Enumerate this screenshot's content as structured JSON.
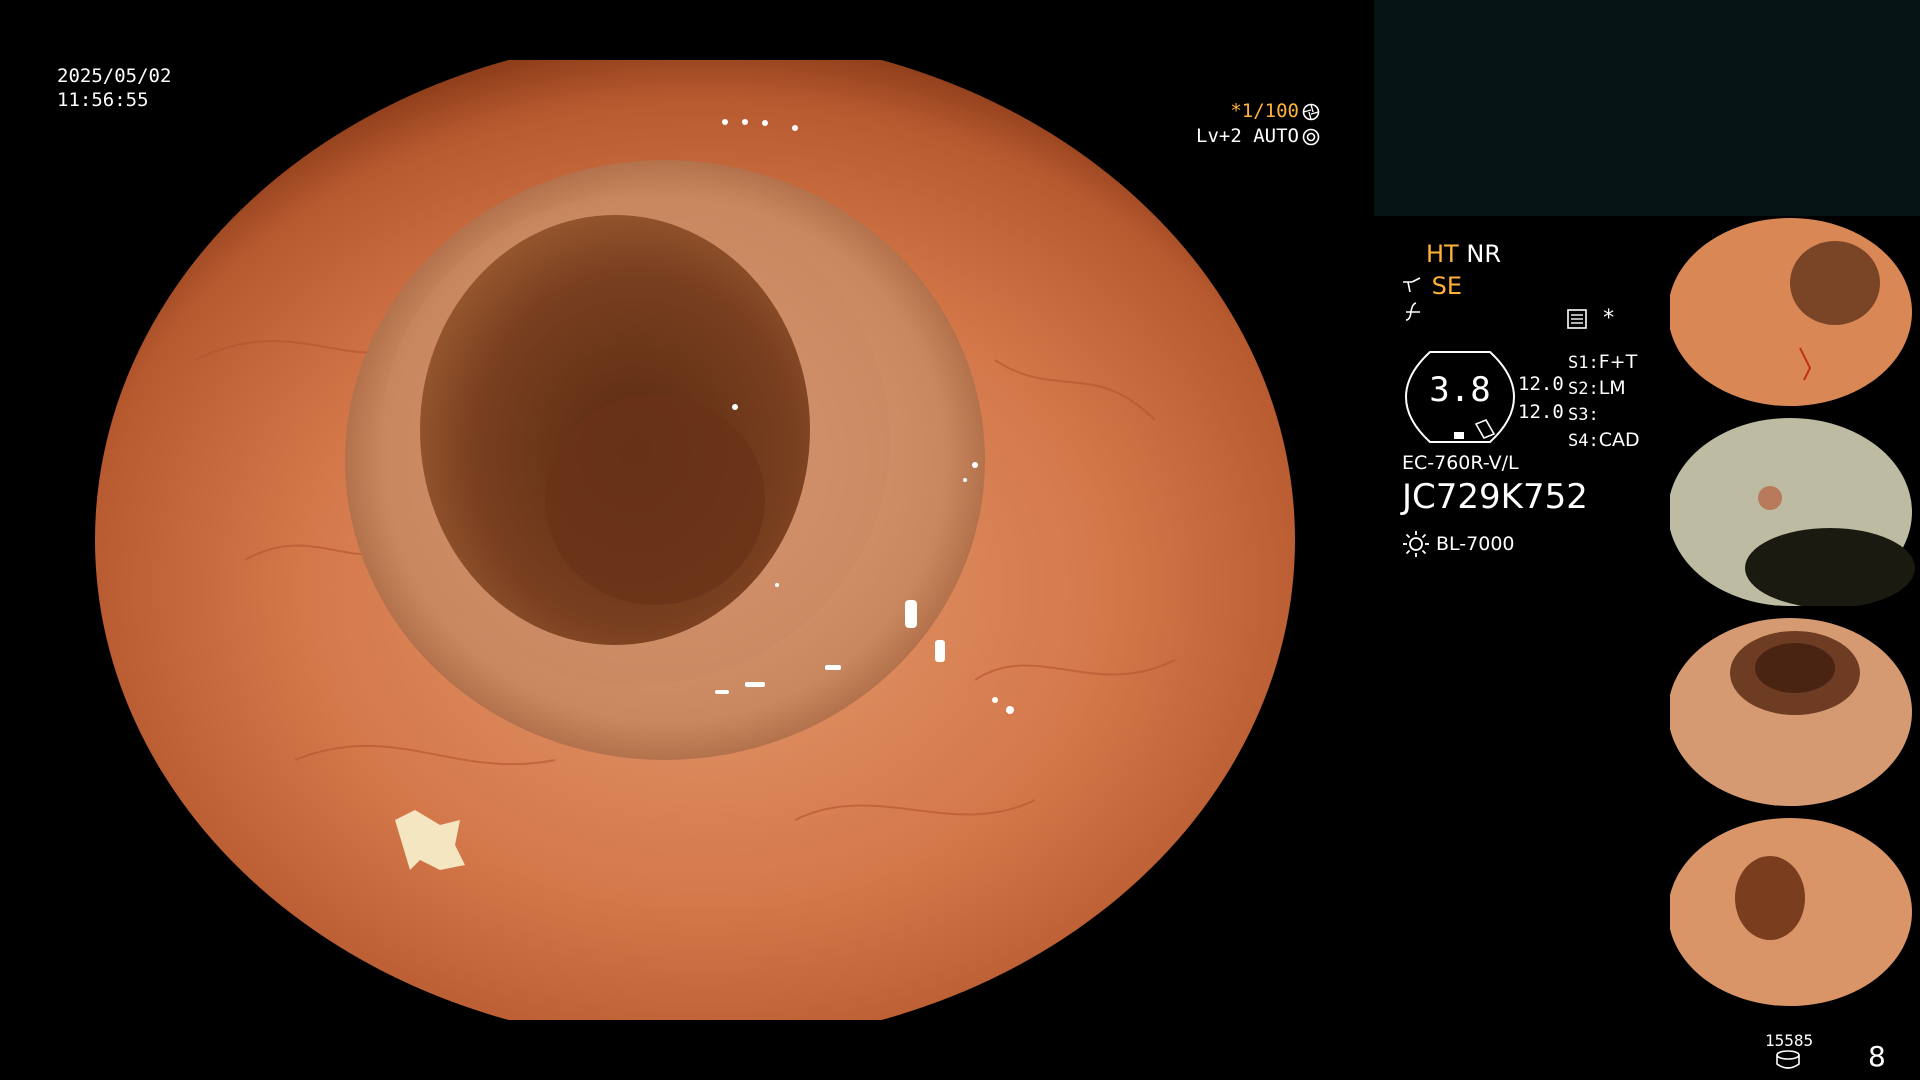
{
  "overlay": {
    "date": "2025/05/02",
    "time": "11:56:55",
    "shutter": "*1/100",
    "level": "Lv+2 AUTO"
  },
  "settings": {
    "ht": "HT",
    "nr": "NR",
    "se": "SE",
    "hex_value": "3.8",
    "gain_top": "12.0",
    "gain_bottom": "12.0",
    "scope_model": "EC-760R-V/L",
    "serial": "JC729K752",
    "light_source": "BL-7000",
    "asterisk": "*"
  },
  "switches": [
    {
      "key": "S1:",
      "value": "F+T"
    },
    {
      "key": "S2:",
      "value": "LM"
    },
    {
      "key": "S3:",
      "value": ""
    },
    {
      "key": "S4:",
      "value": "CAD"
    }
  ],
  "footer": {
    "counter": "15585",
    "page": "8"
  },
  "colors": {
    "accent_orange": "#ffb23a",
    "panel_bg": "#041414",
    "mucosa": "#d27a4c"
  },
  "icons": [
    "shutter-aperture-icon",
    "auto-iris-icon",
    "scope-bend-icon",
    "memory-card-icon",
    "light-sun-icon",
    "disk-icon"
  ]
}
